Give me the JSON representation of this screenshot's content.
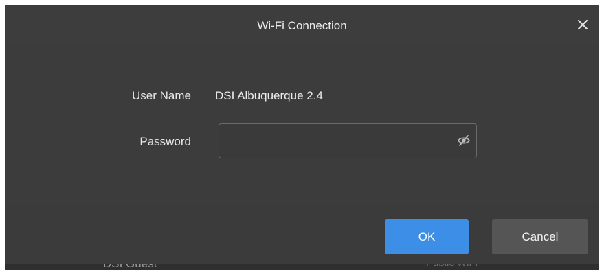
{
  "dialog": {
    "title": "Wi-Fi Connection",
    "close_icon": "close-icon"
  },
  "form": {
    "username_label": "User Name",
    "username_value": "DSI Albuquerque 2.4",
    "password_label": "Password",
    "password_value": "",
    "password_placeholder": "",
    "visibility_icon": "eye-slash-icon"
  },
  "footer": {
    "ok_label": "OK",
    "cancel_label": "Cancel"
  },
  "background": {
    "partial_item_left": "DSI Guest",
    "partial_item_right": "Public WiFi"
  },
  "colors": {
    "primary_button": "#3d8ee6",
    "secondary_button": "#555555",
    "dialog_bg": "#3c3c3c"
  }
}
